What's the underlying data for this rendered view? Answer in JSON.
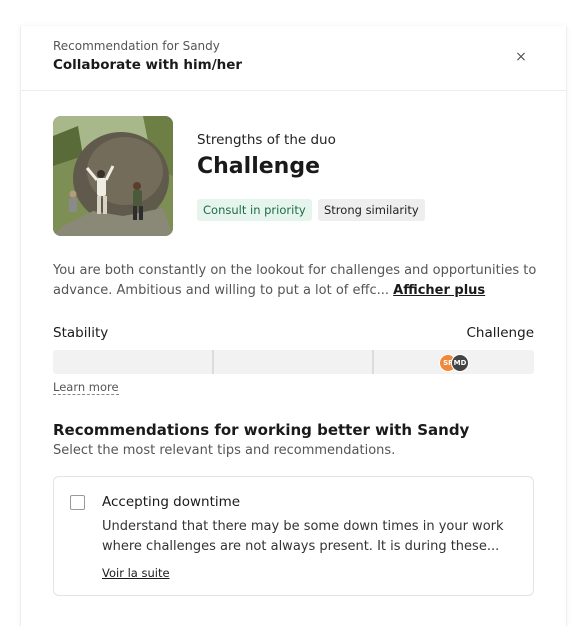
{
  "header": {
    "subtitle": "Recommendation for Sandy",
    "title": "Collaborate with him/her",
    "close_glyph": "×"
  },
  "profile": {
    "photo_icon": "climbing-photo",
    "strengths_label": "Strengths of the duo",
    "strength_title": "Challenge",
    "tags": [
      "Consult in priority",
      "Strong similarity"
    ]
  },
  "description": {
    "text": "You are both constantly on the lookout for challenges and opportunities to advance. Ambitious and willing to put a lot of effc... ",
    "show_more": "Afficher plus"
  },
  "scale": {
    "left_label": "Stability",
    "right_label": "Challenge",
    "avatars": [
      {
        "initials": "SF",
        "color": "#f0883a"
      },
      {
        "initials": "MD",
        "color": "#444444"
      }
    ],
    "learn_more": "Learn more"
  },
  "recommendations": {
    "title": "Recommendations for working better with Sandy",
    "subtitle": "Select the most relevant tips and recommendations.",
    "items": [
      {
        "title": "Accepting downtime",
        "body": "Understand that there may be some down times in your work where challenges are not always present. It is during these...",
        "link": "Voir la suite",
        "checked": false
      }
    ]
  }
}
